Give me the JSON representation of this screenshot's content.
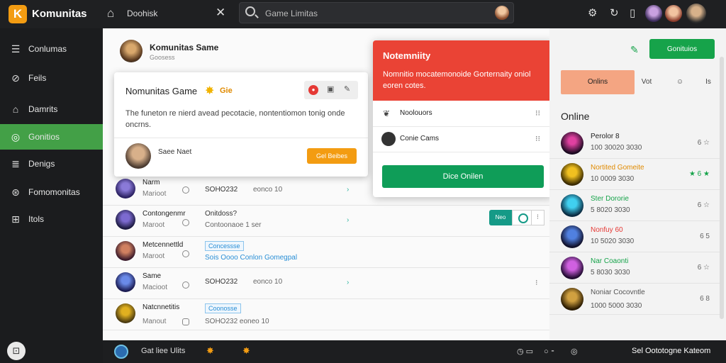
{
  "app": {
    "logo_letter": "K",
    "title": "Komunitas"
  },
  "tab": {
    "label": "Doohisk"
  },
  "search": {
    "placeholder": "Game Limitas"
  },
  "sidebar": {
    "items": [
      {
        "label": "Conlumas",
        "icon": "list-icon"
      },
      {
        "label": "Feils",
        "icon": "compass-icon"
      },
      {
        "label": "Damrits",
        "icon": "home-icon"
      },
      {
        "label": "Gonitios",
        "icon": "discover-icon"
      },
      {
        "label": "Denigs",
        "icon": "document-icon"
      },
      {
        "label": "Fomomonitas",
        "icon": "globe-icon"
      },
      {
        "label": "Itols",
        "icon": "grid-icon"
      }
    ],
    "active_index": 3
  },
  "header": {
    "title": "Komunitas Same",
    "subtitle": "Goosess"
  },
  "card": {
    "title": "Nomunitas Game",
    "badge": "Gie",
    "description": "The funeton re nierd avead pecotacie, nontentiomon tonig onde oncrns.",
    "user": "Saee Naet",
    "button": "Gel Beibes"
  },
  "rows": [
    {
      "name": "Narm",
      "sub": "Marioot",
      "col1": "SOHO232",
      "col2": "eonco 10"
    },
    {
      "name": "Contongenmr",
      "sub": "Maroot",
      "col1": "Onitdoss?",
      "col2": "Contoonaoe 1 ser"
    },
    {
      "name": "Metcennettld",
      "sub": "Maroot",
      "tag": "Concessse",
      "link": "Sois Oooo Conlon Gomegpal"
    },
    {
      "name": "Same",
      "sub": "Macioot",
      "col1": "SOHO232",
      "col2": "eonco 10"
    },
    {
      "name": "Natcnnetitis",
      "sub": "Manout",
      "tag": "Coonosse",
      "col2": "SOHO232 eoneo 10"
    }
  ],
  "toggle": {
    "label": "Neo"
  },
  "notification": {
    "title": "Notemniity",
    "text": "Nomnitio mocatemonoide Gorternaity oniol eoren cotes.",
    "items": [
      {
        "label": "Noolouors",
        "icon": "leaf-icon"
      },
      {
        "label": "Conie Cams",
        "icon": "avatar"
      }
    ],
    "button": "Dice Onilen"
  },
  "right": {
    "primary_button": "Gonituios",
    "tabs": [
      "Onlins",
      "Vot",
      "☺",
      "Is"
    ],
    "online_title": "Online",
    "users": [
      {
        "name": "Perolor 8",
        "sub": "100 30020 3030",
        "status": "6 ☆"
      },
      {
        "name": "Nortited Gomeite",
        "sub": "10 0009 3030",
        "status": "★ 6 ★"
      },
      {
        "name": "Ster Dororie",
        "sub": "5 8020 3030",
        "status": "6 ☆"
      },
      {
        "name": "Nonfuy 60",
        "sub": "10 5020 3030",
        "status": "6 5"
      },
      {
        "name": "Nar Coaonti",
        "sub": "5 8030 3030",
        "status": "6 ☆"
      },
      {
        "name": "Noniar Cocovntle",
        "sub": "1000 5000 3030",
        "status": "6 8"
      }
    ]
  },
  "bottom": {
    "left_text": "Gat liee Ulits",
    "right_text": "Sel Oototogne Kateom"
  },
  "colors": {
    "accent_green": "#43a047",
    "primary_green": "#16a34a",
    "notif_red": "#ea4335",
    "orange": "#f39c12",
    "teal": "#159a87"
  }
}
